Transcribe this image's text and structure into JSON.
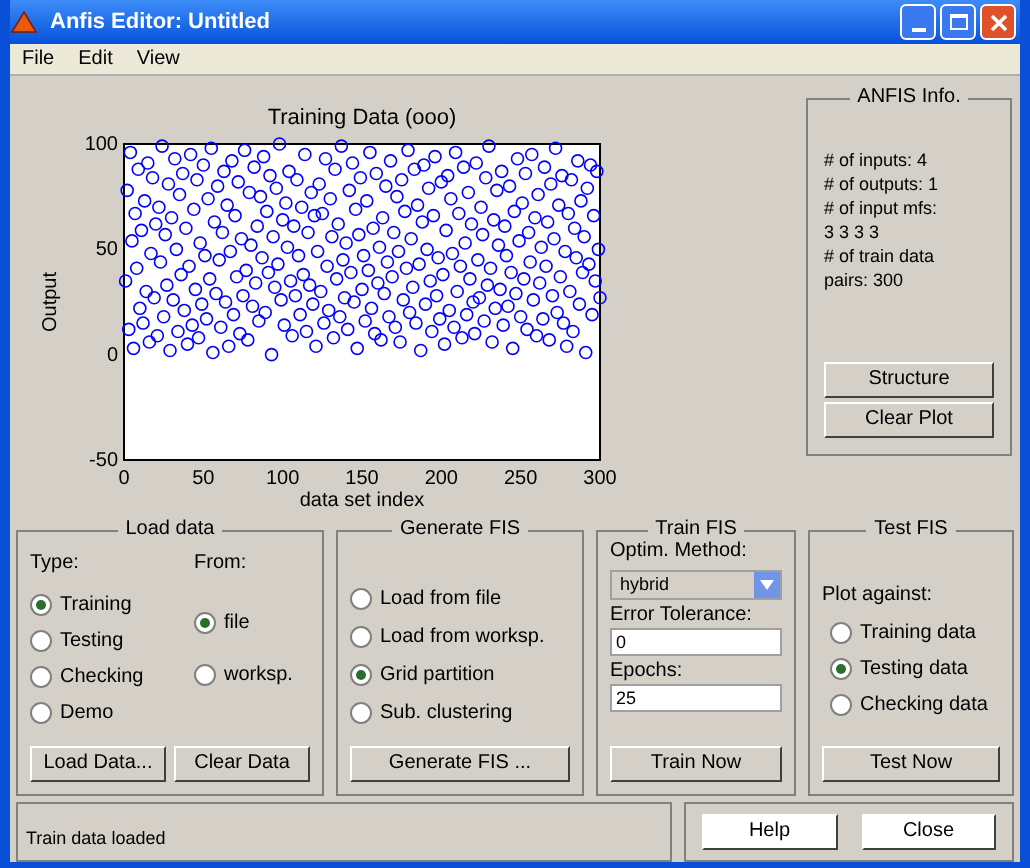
{
  "window": {
    "title": "Anfis Editor: Untitled"
  },
  "menu": [
    "File",
    "Edit",
    "View"
  ],
  "plot": {
    "chart_data": {
      "type": "scatter",
      "title": "Training Data (ooo)",
      "xlabel": "data set index",
      "ylabel": "Output",
      "xlim": [
        0,
        300
      ],
      "ylim": [
        -50,
        100
      ],
      "xticks": [
        0,
        50,
        100,
        150,
        200,
        250,
        300
      ],
      "yticks": [
        -50,
        0,
        50,
        100
      ],
      "x": [
        1,
        2,
        3,
        4,
        5,
        6,
        7,
        8,
        9,
        10,
        11,
        12,
        13,
        14,
        15,
        16,
        17,
        18,
        19,
        20,
        21,
        22,
        23,
        24,
        25,
        26,
        27,
        28,
        29,
        30,
        31,
        32,
        33,
        34,
        35,
        36,
        37,
        38,
        39,
        40,
        41,
        42,
        43,
        44,
        45,
        46,
        47,
        48,
        49,
        50,
        51,
        52,
        53,
        54,
        55,
        56,
        57,
        58,
        59,
        60,
        61,
        62,
        63,
        64,
        65,
        66,
        67,
        68,
        69,
        70,
        71,
        72,
        73,
        74,
        75,
        76,
        77,
        78,
        79,
        80,
        81,
        82,
        83,
        84,
        85,
        86,
        87,
        88,
        89,
        90,
        91,
        92,
        93,
        94,
        95,
        96,
        97,
        98,
        99,
        100,
        101,
        102,
        103,
        104,
        105,
        106,
        107,
        108,
        109,
        110,
        111,
        112,
        113,
        114,
        115,
        116,
        117,
        118,
        119,
        120,
        121,
        122,
        123,
        124,
        125,
        126,
        127,
        128,
        129,
        130,
        131,
        132,
        133,
        134,
        135,
        136,
        137,
        138,
        139,
        140,
        141,
        142,
        143,
        144,
        145,
        146,
        147,
        148,
        149,
        150,
        151,
        152,
        153,
        154,
        155,
        156,
        157,
        158,
        159,
        160,
        161,
        162,
        163,
        164,
        165,
        166,
        167,
        168,
        169,
        170,
        171,
        172,
        173,
        174,
        175,
        176,
        177,
        178,
        179,
        180,
        181,
        182,
        183,
        184,
        185,
        186,
        187,
        188,
        189,
        190,
        191,
        192,
        193,
        194,
        195,
        196,
        197,
        198,
        199,
        200,
        201,
        202,
        203,
        204,
        205,
        206,
        207,
        208,
        209,
        210,
        211,
        212,
        213,
        214,
        215,
        216,
        217,
        218,
        219,
        220,
        221,
        222,
        223,
        224,
        225,
        226,
        227,
        228,
        229,
        230,
        231,
        232,
        233,
        234,
        235,
        236,
        237,
        238,
        239,
        240,
        241,
        242,
        243,
        244,
        245,
        246,
        247,
        248,
        249,
        250,
        251,
        252,
        253,
        254,
        255,
        256,
        257,
        258,
        259,
        260,
        261,
        262,
        263,
        264,
        265,
        266,
        267,
        268,
        269,
        270,
        271,
        272,
        273,
        274,
        275,
        276,
        277,
        278,
        279,
        280,
        281,
        282,
        283,
        284,
        285,
        286,
        287,
        288,
        289,
        290,
        291,
        292,
        293,
        294,
        295,
        296,
        297,
        298,
        299,
        300
      ],
      "series": [
        {
          "color": "#0000ff",
          "values": [
            35,
            78,
            12,
            96,
            54,
            3,
            67,
            41,
            88,
            22,
            59,
            15,
            73,
            30,
            91,
            6,
            48,
            84,
            27,
            62,
            9,
            70,
            44,
            99,
            18,
            57,
            33,
            81,
            2,
            65,
            26,
            93,
            50,
            11,
            76,
            38,
            86,
            21,
            60,
            5,
            42,
            95,
            14,
            69,
            31,
            83,
            8,
            53,
            24,
            90,
            47,
            17,
            74,
            36,
            98,
            1,
            63,
            29,
            80,
            45,
            13,
            58,
            87,
            25,
            71,
            4,
            49,
            92,
            19,
            66,
            37,
            82,
            10,
            55,
            28,
            97,
            40,
            7,
            77,
            52,
            23,
            89,
            34,
            61,
            16,
            75,
            46,
            94,
            20,
            68,
            39,
            85,
            0,
            56,
            32,
            79,
            43,
            100,
            26,
            64,
            14,
            72,
            51,
            87,
            35,
            9,
            61,
            28,
            83,
            47,
            19,
            70,
            38,
            95,
            11,
            58,
            33,
            77,
            24,
            66,
            4,
            49,
            81,
            30,
            67,
            15,
            93,
            42,
            21,
            74,
            56,
            8,
            88,
            36,
            62,
            18,
            99,
            45,
            27,
            53,
            12,
            78,
            39,
            91,
            25,
            69,
            3,
            57,
            84,
            31,
            47,
            16,
            73,
            40,
            96,
            22,
            60,
            10,
            86,
            34,
            51,
            7,
            65,
            29,
            80,
            44,
            18,
            92,
            37,
            58,
            13,
            75,
            49,
            6,
            83,
            26,
            68,
            41,
            97,
            20,
            55,
            32,
            88,
            15,
            71,
            43,
            2,
            63,
            90,
            24,
            50,
            79,
            35,
            11,
            66,
            94,
            28,
            46,
            17,
            82,
            38,
            5,
            59,
            85,
            21,
            74,
            48,
            13,
            96,
            30,
            67,
            42,
            8,
            89,
            53,
            19,
            77,
            36,
            62,
            25,
            10,
            91,
            45,
            27,
            70,
            57,
            16,
            84,
            33,
            99,
            41,
            6,
            64,
            22,
            78,
            52,
            31,
            87,
            14,
            61,
            47,
            23,
            80,
            39,
            3,
            68,
            29,
            93,
            54,
            18,
            72,
            36,
            86,
            12,
            58,
            44,
            95,
            26,
            65,
            9,
            76,
            34,
            51,
            17,
            89,
            42,
            63,
            7,
            81,
            28,
            55,
            98,
            20,
            71,
            37,
            85,
            15,
            49,
            4,
            67,
            30,
            83,
            11,
            60,
            46,
            92,
            24,
            73,
            39,
            56,
            1,
            79,
            43,
            90,
            19,
            66,
            35,
            87,
            50,
            27
          ]
        }
      ]
    }
  },
  "anfis_info": {
    "title": "ANFIS Info.",
    "lines": [
      "# of inputs: 4",
      "# of outputs: 1",
      "# of input mfs:",
      "3 3 3 3",
      "# of train data",
      "pairs: 300"
    ],
    "buttons": [
      "Structure",
      "Clear Plot"
    ]
  },
  "load_data": {
    "title": "Load data",
    "type_label": "Type:",
    "from_label": "From:",
    "type_options": [
      {
        "label": "Training",
        "selected": true
      },
      {
        "label": "Testing",
        "selected": false
      },
      {
        "label": "Checking",
        "selected": false
      },
      {
        "label": "Demo",
        "selected": false
      }
    ],
    "from_options": [
      {
        "label": "file",
        "selected": true
      },
      {
        "label": "worksp.",
        "selected": false
      }
    ],
    "buttons": [
      "Load Data...",
      "Clear Data"
    ]
  },
  "generate_fis": {
    "title": "Generate FIS",
    "options": [
      {
        "label": "Load from file",
        "selected": false
      },
      {
        "label": "Load from worksp.",
        "selected": false
      },
      {
        "label": "Grid partition",
        "selected": true
      },
      {
        "label": "Sub. clustering",
        "selected": false
      }
    ],
    "button": "Generate FIS ..."
  },
  "train_fis": {
    "title": "Train FIS",
    "method_label": "Optim. Method:",
    "method": "hybrid",
    "tolerance_label": "Error Tolerance:",
    "tolerance": "0",
    "epochs_label": "Epochs:",
    "epochs": "25",
    "button": "Train Now"
  },
  "test_fis": {
    "title": "Test FIS",
    "plot_label": "Plot against:",
    "options": [
      {
        "label": "Training data",
        "selected": false
      },
      {
        "label": "Testing data",
        "selected": true
      },
      {
        "label": "Checking data",
        "selected": false
      }
    ],
    "button": "Test Now"
  },
  "status": "Train data loaded",
  "buttons": [
    "Help",
    "Close"
  ]
}
